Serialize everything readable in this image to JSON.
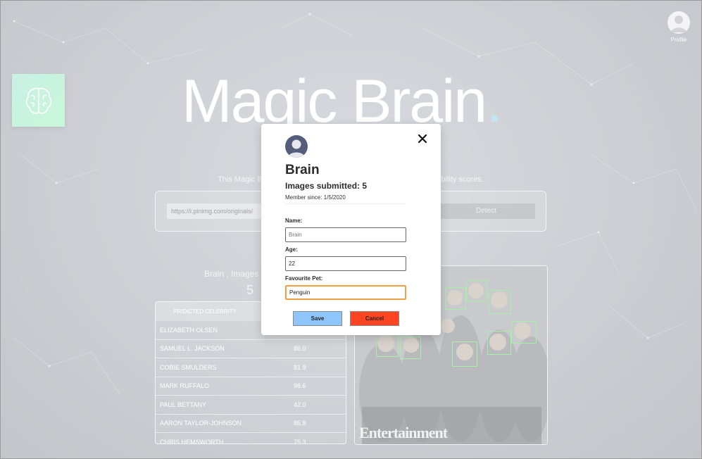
{
  "header": {
    "profile_label": "Profile",
    "profile_icon": "user-avatar-icon"
  },
  "logo": {
    "icon": "brain-icon"
  },
  "hero": {
    "title": "Magic Brain",
    "title_dot": "."
  },
  "detector": {
    "subtitle": "This Magic Brain will detect celebrities in your pictures with probability scores.",
    "url_value": "https://i.pinimg.com/originals/",
    "detect_label": "Detect"
  },
  "user_stats": {
    "text": "Brain , Images submitted:",
    "count": "5"
  },
  "results_table": {
    "header": "PRIDICTED CELEBRITY",
    "rows": [
      {
        "name": "ELIZABETH OLSEN",
        "score": ""
      },
      {
        "name": "SAMUEL L. JACKSON",
        "score": "86.0"
      },
      {
        "name": "COBIE SMULDERS",
        "score": "81.9"
      },
      {
        "name": "MARK RUFFALO",
        "score": "96.6"
      },
      {
        "name": "PAUL BETTANY",
        "score": "42.0"
      },
      {
        "name": "AARON TAYLOR-JOHNSON",
        "score": "86.8"
      },
      {
        "name": "CHRIS HEMSWORTH",
        "score": "75.3"
      }
    ]
  },
  "photo": {
    "watermark": "Entertainment"
  },
  "profile_modal": {
    "user_name": "Brain",
    "images_submitted": "Images submitted: 5",
    "member_since": "Member since: 1/5/2020",
    "name_label": "Name:",
    "name_placeholder": "Brain",
    "age_label": "Age:",
    "age_value": "22",
    "pet_label": "Favourite Pet:",
    "pet_value": "Penguin",
    "save_label": "Save",
    "cancel_label": "Cancel",
    "close_icon": "close-icon"
  },
  "colors": {
    "save_button": "#8ec6fb",
    "cancel_button": "#ff4422",
    "focus_outline": "#f0a040",
    "modal_avatar": "#545d7a",
    "face_box": "#a8f0a8"
  }
}
